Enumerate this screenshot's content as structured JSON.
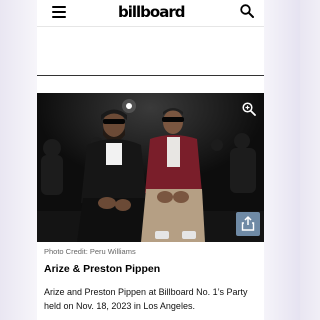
{
  "header": {
    "logo_text": "billboard",
    "menu_icon": "hamburger-menu-icon",
    "search_icon": "search-icon"
  },
  "gallery": {
    "photo_alt": "Arize and Preston Pippen",
    "photo_credit": "Photo Credit: Peru Williams",
    "title": "Arize & Preston Pippen",
    "caption": "Arize and Preston Pippen at Billboard No. 1’s Party held on Nov. 18, 2023 in Los Angeles.",
    "zoom_icon": "zoom-in-icon",
    "share_icon": "share-icon"
  },
  "colors": {
    "share_button": "#6f8aa5",
    "photo_background": "#0d0d0d"
  }
}
